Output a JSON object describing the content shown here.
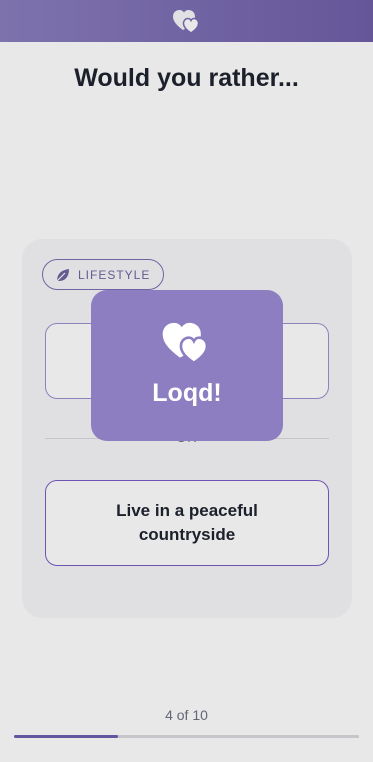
{
  "header": {
    "logo_icon": "hearts-logo-icon"
  },
  "main": {
    "title": "Would you rather...",
    "category": {
      "label": "LIFESTYLE",
      "icon": "leaf-icon"
    },
    "option_a": {
      "text": ""
    },
    "divider_label": "OR",
    "option_b": {
      "text": "Live in a peaceful countryside"
    }
  },
  "progress": {
    "text": "4 of 10",
    "current": 4,
    "total": 10,
    "fraction": 0.3
  },
  "toast": {
    "text": "Loqd!",
    "icon": "hearts-icon"
  },
  "colors": {
    "accent": "#8c7ec0",
    "accent_dark": "#6d5fb0",
    "title": "#1f2430"
  }
}
